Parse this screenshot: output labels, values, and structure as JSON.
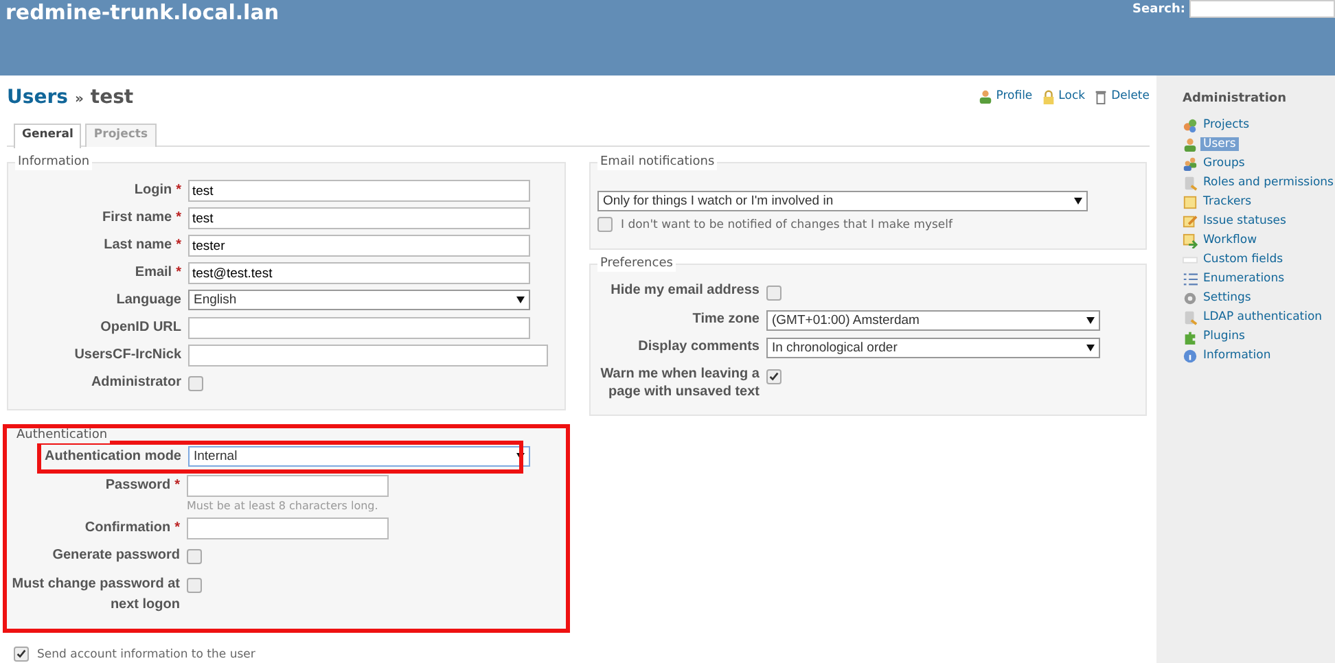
{
  "header": {
    "title": "redmine-trunk.local.lan",
    "search_label": "Search:"
  },
  "page_title": {
    "link": "Users",
    "separator": "»",
    "name": "test"
  },
  "actions": [
    {
      "label": "Profile",
      "kind": "profile"
    },
    {
      "label": "Lock",
      "kind": "lock"
    },
    {
      "label": "Delete",
      "kind": "delete"
    }
  ],
  "tabs": [
    {
      "label": "General",
      "selected": true
    },
    {
      "label": "Projects",
      "selected": false
    }
  ],
  "information": {
    "legend": "Information",
    "highlighted": false,
    "fields": [
      {
        "label": "Login",
        "required_mark": "*",
        "kind": "text",
        "value": "test"
      },
      {
        "label": "First name",
        "required_mark": "*",
        "kind": "text",
        "value": "test"
      },
      {
        "label": "Last name",
        "required_mark": "*",
        "kind": "text",
        "value": "tester"
      },
      {
        "label": "Email",
        "required_mark": "*",
        "kind": "text",
        "value": "test@test.test"
      },
      {
        "label": "Language",
        "kind": "select",
        "value": "English"
      },
      {
        "label": "OpenID URL",
        "kind": "text"
      },
      {
        "label": "UsersCF-IrcNick",
        "kind": "wide_text"
      },
      {
        "label": "Administrator",
        "kind": "checkbox",
        "checked": false
      }
    ]
  },
  "authentication": {
    "legend": "Authentication",
    "highlighted": true,
    "fields": [
      {
        "label": "Authentication mode",
        "kind": "select",
        "value": "Internal",
        "highlighted": true
      },
      {
        "label": "Password",
        "required_mark": "*",
        "kind": "short_text",
        "hint": "Must be at least 8 characters long."
      },
      {
        "label": "Confirmation",
        "required_mark": "*",
        "kind": "short_text"
      },
      {
        "label": "Generate password",
        "kind": "checkbox",
        "checked": false
      },
      {
        "label": "Must change password at next logon",
        "kind": "checkbox",
        "checked": false
      }
    ]
  },
  "send_info": {
    "label": "Send account information to the user",
    "checked": true
  },
  "email_notifications": {
    "legend": "Email notifications",
    "value": "Only for things I watch or I'm involved in",
    "option": {
      "label": "I don't want to be notified of changes that I make myself",
      "checked": false
    }
  },
  "preferences": {
    "legend": "Preferences",
    "highlighted": false,
    "fields": [
      {
        "label": "Hide my email address",
        "kind": "checkbox",
        "checked": false
      },
      {
        "label": "Time zone",
        "kind": "select",
        "value": "(GMT+01:00) Amsterdam"
      },
      {
        "label": "Display comments",
        "kind": "select",
        "value": "In chronological order"
      },
      {
        "label": "Warn me when leaving a page with unsaved text",
        "kind": "checkbox",
        "checked": true
      }
    ]
  },
  "sidebar": {
    "title": "Administration",
    "items": [
      {
        "label": "Projects",
        "kind": "projects",
        "selected": false
      },
      {
        "label": "Users",
        "kind": "users",
        "selected": true
      },
      {
        "label": "Groups",
        "kind": "groups",
        "selected": false
      },
      {
        "label": "Roles and permissions",
        "kind": "roles",
        "selected": false
      },
      {
        "label": "Trackers",
        "kind": "trackers",
        "selected": false
      },
      {
        "label": "Issue statuses",
        "kind": "statuses",
        "selected": false
      },
      {
        "label": "Workflow",
        "kind": "workflow",
        "selected": false
      },
      {
        "label": "Custom fields",
        "kind": "custom",
        "selected": false
      },
      {
        "label": "Enumerations",
        "kind": "enumerations",
        "selected": false
      },
      {
        "label": "Settings",
        "kind": "settings",
        "selected": false
      },
      {
        "label": "LDAP authentication",
        "kind": "ldap",
        "selected": false
      },
      {
        "label": "Plugins",
        "kind": "plugins",
        "selected": false
      },
      {
        "label": "Information",
        "kind": "info",
        "selected": false
      }
    ]
  }
}
